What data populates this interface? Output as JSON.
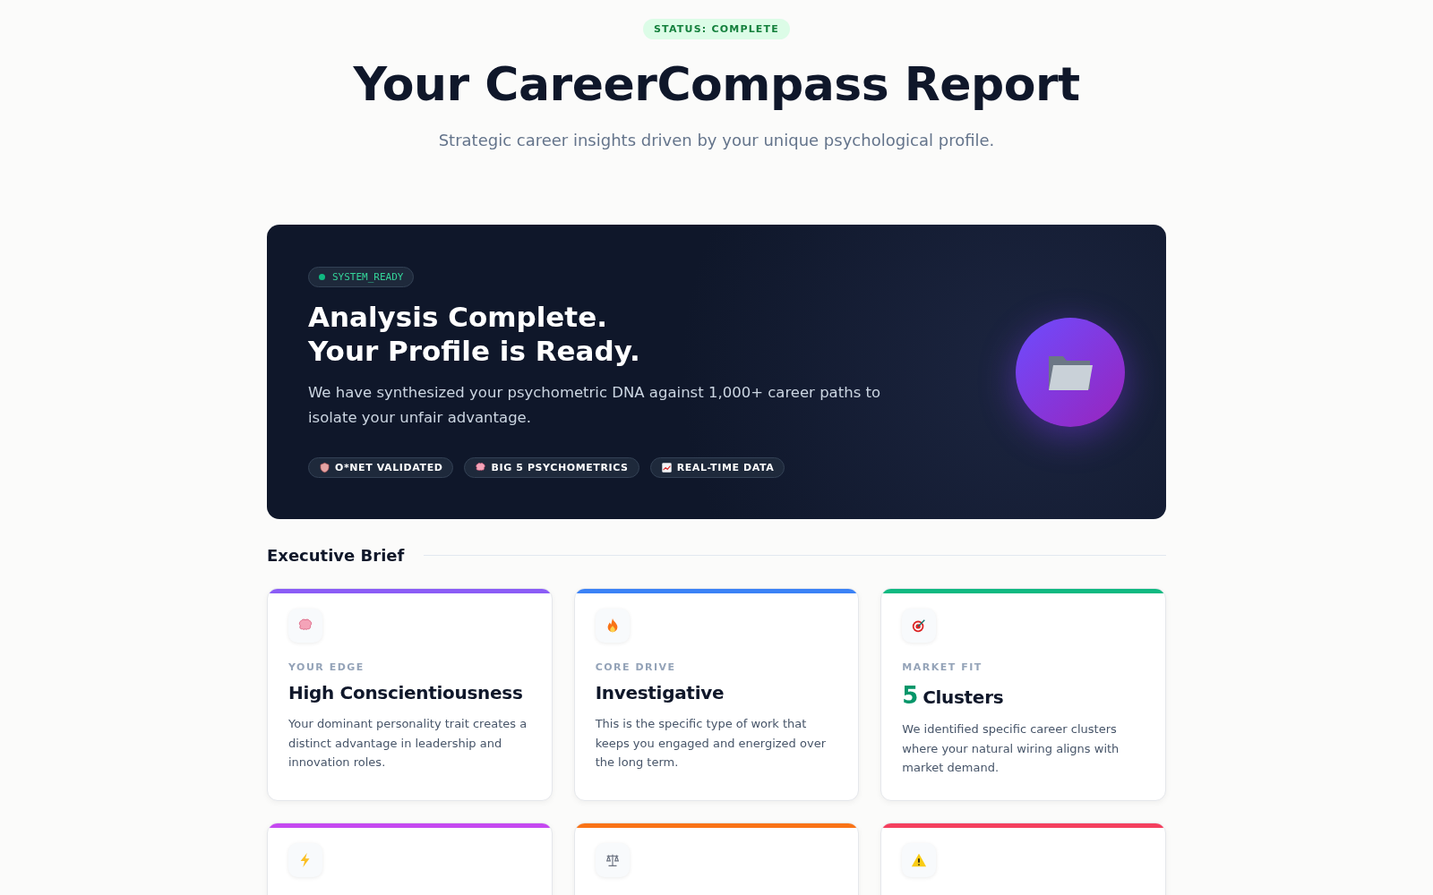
{
  "status_badge": "STATUS: COMPLETE",
  "title": "Your CareerCompass Report",
  "subtitle": "Strategic career insights driven by your unique psychological profile.",
  "hero": {
    "status_chip": "SYSTEM_READY",
    "heading_lines": [
      "Analysis Complete.",
      "Your Profile is Ready."
    ],
    "description": "We have synthesized your psychometric DNA against 1,000+ career paths to isolate your unfair advantage.",
    "tags": [
      {
        "label": "O*NET VALIDATED"
      },
      {
        "label": "BIG 5 PSYCHOMETRICS"
      },
      {
        "label": "REAL-TIME DATA"
      }
    ]
  },
  "section_title": "Executive Brief",
  "cards": [
    {
      "color": "#8b5cf6",
      "kind": "text",
      "label": "YOUR EDGE",
      "value": "High Conscientiousness",
      "description": "Your dominant personality trait creates a distinct advantage in leadership and innovation roles."
    },
    {
      "color": "#3b82f6",
      "kind": "text",
      "label": "CORE DRIVE",
      "value": "Investigative",
      "description": "This is the specific type of work that keeps you engaged and energized over the long term."
    },
    {
      "color": "#10b981",
      "kind": "count",
      "label": "MARKET FIT",
      "number": "5",
      "value": "Clusters",
      "description": "We identified specific career clusters where your natural wiring aligns with market demand."
    },
    {
      "color": "#c548f0"
    },
    {
      "color": "#f97316"
    },
    {
      "color": "#f43f5e"
    }
  ]
}
